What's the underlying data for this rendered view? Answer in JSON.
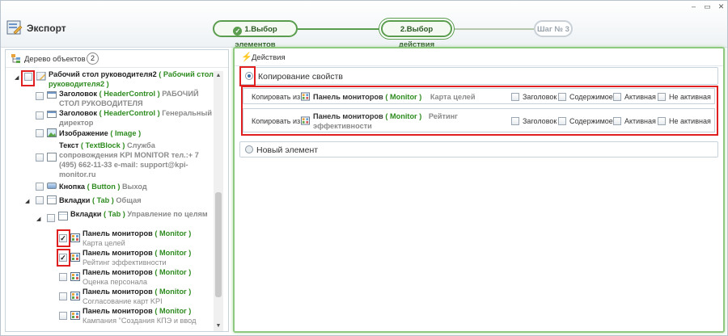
{
  "window": {
    "title": "Экспорт",
    "controls": {
      "minimize": "–",
      "maximize": "▭",
      "close": "✕"
    }
  },
  "steps": [
    {
      "label": "1.Выбор элементов",
      "state": "done"
    },
    {
      "label": "2.Выбор действия",
      "state": "active"
    },
    {
      "label": "Шаг № 3",
      "state": "future"
    }
  ],
  "tree": {
    "header": "Дерево объектов",
    "count": "2",
    "nodes": [
      {
        "name": "Рабочий стол руководителя2",
        "type": "Рабочий стол руководителя2",
        "open": "(",
        "close": ")",
        "caption": ""
      },
      {
        "name": "Заголовок",
        "type": "HeaderControl",
        "open": "(",
        "close": ")",
        "caption": "РАБОЧИЙ СТОЛ РУКОВОДИТЕЛЯ"
      },
      {
        "name": "Заголовок",
        "type": "HeaderControl",
        "open": "(",
        "close": ")",
        "caption": "Генеральный директор"
      },
      {
        "name": "Изображение",
        "type": "Image",
        "open": "(",
        "close": ")",
        "caption": ""
      },
      {
        "name": "Текст",
        "type": "TextBlock",
        "open": "(",
        "close": ")",
        "caption": "Служба сопровождения KPI MONITOR тел.:+ 7 (495) 662-11-33 e-mail: support@kpi-monitor.ru"
      },
      {
        "name": "Кнопка",
        "type": "Button",
        "open": "(",
        "close": ")",
        "caption": "Выход"
      },
      {
        "name": "Вкладки",
        "type": "Tab",
        "open": "(",
        "close": ")",
        "caption": "Общая"
      },
      {
        "name": "Вкладки",
        "type": "Tab",
        "open": "(",
        "close": ")",
        "caption": "Управление по целям"
      },
      {
        "name": "Панель мониторов",
        "type": "Monitor",
        "open": "(",
        "close": ")",
        "caption": "Карта целей",
        "checked": true
      },
      {
        "name": "Панель мониторов",
        "type": "Monitor",
        "open": "(",
        "close": ")",
        "caption": "Рейтинг эффективности",
        "checked": true
      },
      {
        "name": "Панель мониторов",
        "type": "Monitor",
        "open": "(",
        "close": ")",
        "caption": "Оценка персонала"
      },
      {
        "name": "Панель мониторов",
        "type": "Monitor",
        "open": "(",
        "close": ")",
        "caption": "Согласование карт KPI"
      },
      {
        "name": "Панель мониторов",
        "type": "Monitor",
        "open": "(",
        "close": ")",
        "caption": "Кампания \"Создания КПЭ и ввод"
      }
    ]
  },
  "actions": {
    "header": "Действия",
    "copy_properties": {
      "label": "Копирование свойств",
      "rows": [
        {
          "from_label": "Копировать из :",
          "name": "Панель мониторов",
          "type": "Monitor",
          "open": "(",
          "close": ")",
          "caption": "Карта целей"
        },
        {
          "from_label": "Копировать из :",
          "name": "Панель мониторов",
          "type": "Monitor",
          "open": "(",
          "close": ")",
          "caption": "Рейтинг эффективности"
        }
      ],
      "options": [
        "Заголовок",
        "Содержимое",
        "Активная",
        "Не активная"
      ]
    },
    "new_element": {
      "label": "Новый элемент"
    }
  },
  "colors": {
    "accent_green": "#5a9d4e",
    "type_green": "#2e8b1f",
    "highlight_red": "#e02020"
  }
}
